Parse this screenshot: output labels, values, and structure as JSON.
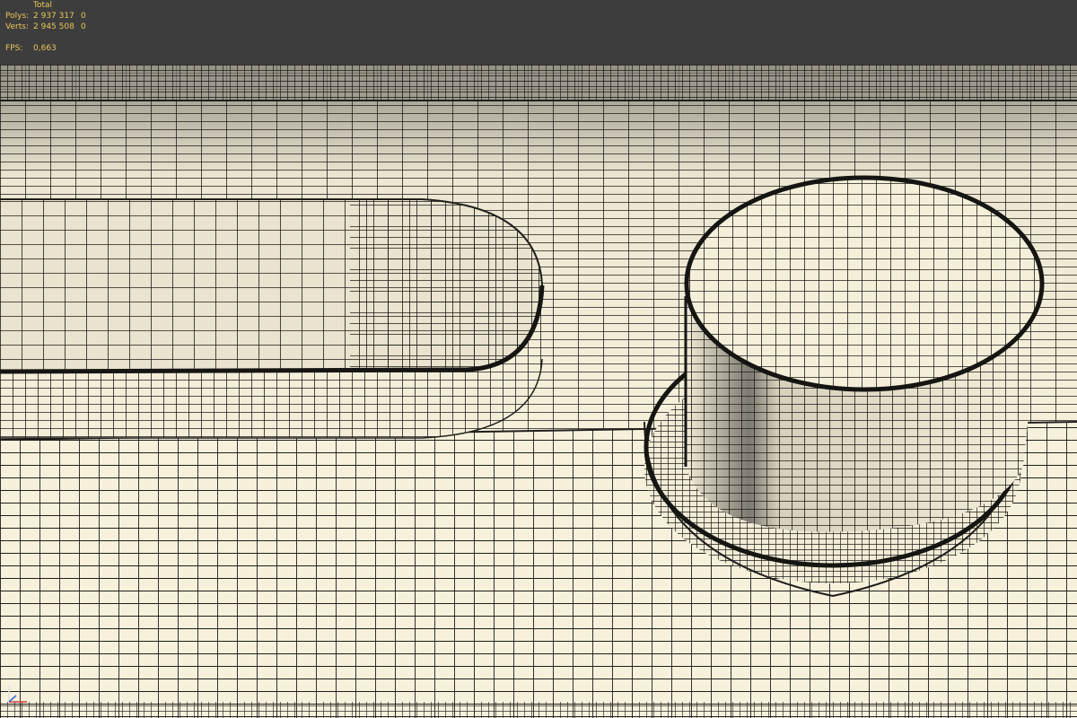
{
  "stats": {
    "header": "Total",
    "polys": {
      "label": "Polys:",
      "total": "2 937 317",
      "selected": "0"
    },
    "verts": {
      "label": "Verts:",
      "total": "2 945 508",
      "selected": "0"
    },
    "fps": {
      "label": "FPS:",
      "value": "0,663"
    }
  },
  "viewport": {
    "background_color": "#3d3d3d",
    "surface_color": "#f7f1dc",
    "wire_color": "#1e1e1a",
    "shading": "wireframe-over-shaded",
    "objects": [
      "back-ledge",
      "rounded-slot-bar",
      "cylinder-knob",
      "cylinder-base",
      "floor-slab"
    ]
  },
  "gizmo": {
    "icon": "axis-tripod-icon",
    "x_color": "#d33a3a",
    "y_color": "#3a6ad3",
    "z_color": "#e0e0e0"
  }
}
